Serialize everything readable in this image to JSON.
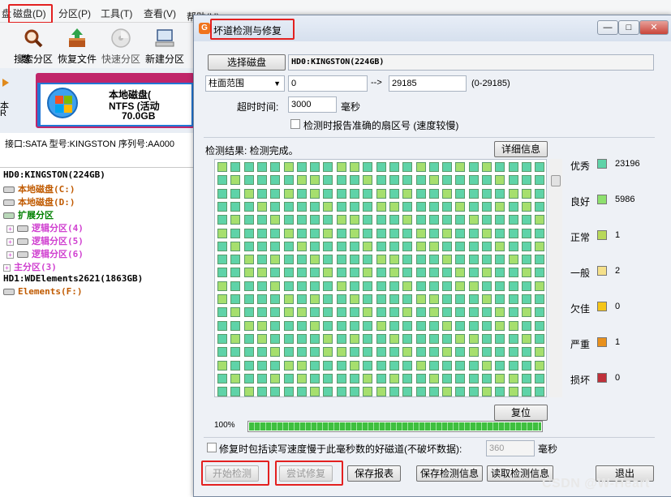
{
  "menubar": {
    "items": [
      {
        "label": "盘"
      },
      {
        "label": "磁盘(D)"
      },
      {
        "label": "分区(P)"
      },
      {
        "label": "工具(T)"
      },
      {
        "label": "查看(V)"
      },
      {
        "label": "帮助(H)"
      }
    ]
  },
  "toolbar": {
    "items": [
      {
        "label": "数",
        "icon": "clipped-icon"
      },
      {
        "label": "搜索分区",
        "icon": "magnifier-icon"
      },
      {
        "label": "恢复文件",
        "icon": "recover-box-icon"
      },
      {
        "label": "快速分区",
        "icon": "disk-icon"
      },
      {
        "label": "新建分区",
        "icon": "computer-icon"
      }
    ]
  },
  "disk_banner": {
    "left_text_1": "本",
    "left_text_2": "R",
    "partition_name": "本地磁盘(",
    "partition_fs": "NTFS (活动",
    "partition_size": "70.0GB"
  },
  "disk_info": {
    "text": "接口:SATA  型号:KINGSTON  序列号:AA000"
  },
  "tree": {
    "items": [
      {
        "label": "HD0:KINGSTON(224GB)",
        "color": "#000000",
        "level": 0
      },
      {
        "label": "本地磁盘(C:)",
        "color": "#c05a00",
        "level": 1
      },
      {
        "label": "本地磁盘(D:)",
        "color": "#c05a00",
        "level": 1
      },
      {
        "label": "扩展分区",
        "color": "#008000",
        "level": 1
      },
      {
        "label": "逻辑分区(4)",
        "color": "#d040d0",
        "level": 2
      },
      {
        "label": "逻辑分区(5)",
        "color": "#d040d0",
        "level": 2
      },
      {
        "label": "逻辑分区(6)",
        "color": "#d040d0",
        "level": 2
      },
      {
        "label": "主分区(3)",
        "color": "#d040d0",
        "level": 1
      },
      {
        "label": "HD1:WDElements2621(1863GB)",
        "color": "#000000",
        "level": 0
      },
      {
        "label": "Elements(F:)",
        "color": "#c05a00",
        "level": 1
      }
    ]
  },
  "dialog": {
    "title": "坏道检测与修复",
    "min_label": "—",
    "max_label": "□",
    "close_label": "✕",
    "select_disk_label": "选择磁盘",
    "disk_name": "HD0:KINGSTON(224GB)",
    "range_type": "柱面范围",
    "range_start": "0",
    "range_arrow": "-->",
    "range_end": "29185",
    "range_hint": "(0-29185)",
    "timeout_label": "超时时间:",
    "timeout_value": "3000",
    "timeout_unit": "毫秒",
    "report_sector_label": "检测时报告准确的扇区号 (速度较慢)",
    "result_label": "检测结果: 检测完成。",
    "details_button": "详细信息",
    "reset_button": "复位",
    "progress_text": "100%",
    "progress_value": 1.0,
    "repair_slow_label": "修复时包括读写速度慢于此毫秒数的好磁道(不破坏数据):",
    "repair_slow_value": "360",
    "repair_slow_unit": "毫秒",
    "start_button": "开始检测",
    "try_repair_button": "尝试修复",
    "save_report_button": "保存报表",
    "save_info_button": "保存检测信息",
    "read_info_button": "读取检测信息",
    "exit_button": "退出"
  },
  "legend": [
    {
      "label": "优秀",
      "color": "#5fd3a8",
      "count": "23196"
    },
    {
      "label": "良好",
      "color": "#8ee06e",
      "count": "5986"
    },
    {
      "label": "正常",
      "color": "#b8d85a",
      "count": "1"
    },
    {
      "label": "一般",
      "color": "#f5e08a",
      "count": "2"
    },
    {
      "label": "欠佳",
      "color": "#f5c518",
      "count": "0"
    },
    {
      "label": "严重",
      "color": "#e8901c",
      "count": "1"
    },
    {
      "label": "损坏",
      "color": "#c0303a",
      "count": "0"
    }
  ],
  "watermark": "CSDN @W-Heart",
  "colors": {
    "grid_excellent": "#5fd3a8",
    "grid_good": "#a6df6e",
    "highlight_red": "#e32020"
  }
}
